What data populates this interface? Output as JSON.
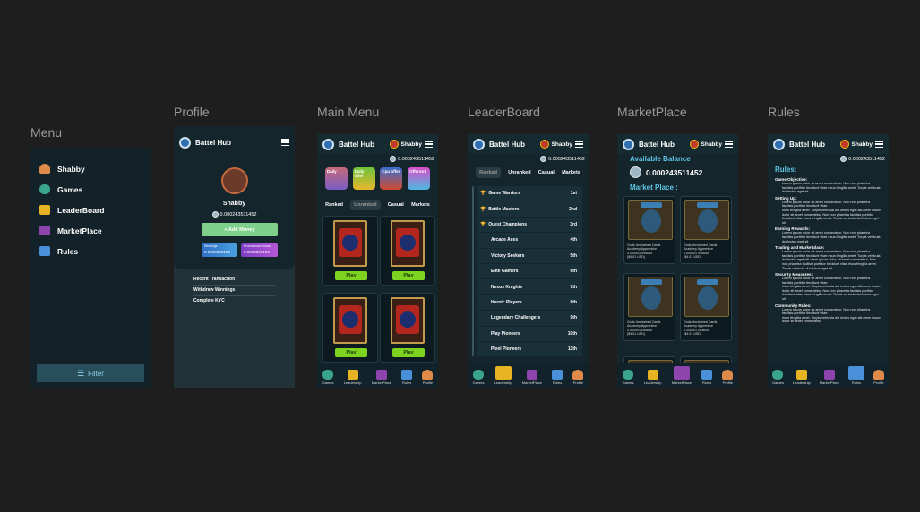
{
  "frames": {
    "menu": "Menu",
    "profile": "Profile",
    "main_menu": "Main Menu",
    "leaderboard": "LeaderBoard",
    "marketplace": "MarketPlace",
    "rules": "Rules"
  },
  "app_name": "Battel Hub",
  "user_name": "Shabby",
  "balance": "0.000243511452",
  "menu": {
    "items": [
      "Shabby",
      "Games",
      "LeaderBoard",
      "MarketPlace",
      "Rules"
    ],
    "filter": "Filter"
  },
  "profile": {
    "name": "Shabby",
    "balance": "0.000243511452",
    "add_money": "+ Add Money",
    "stat1_label": "Winnings",
    "stat1_value": "0.0000000123",
    "stat2_label": "Promotional Bonus",
    "stat2_value": "0.0000000123",
    "links": [
      "Recent Transaction",
      "Withdraw Winnings",
      "Complete KYC"
    ]
  },
  "main": {
    "offers": [
      "Daily",
      "Daily offer",
      "Cpu offer",
      "Offeroo1"
    ],
    "tabs": [
      "Ranked",
      "Unranked",
      "Casual",
      "Markets"
    ],
    "play": "Play"
  },
  "leaderboard": {
    "tabs": [
      "Ranked",
      "Unranked",
      "Casual",
      "Markets"
    ],
    "rows": [
      {
        "name": "Game Warriors",
        "rank": "1st"
      },
      {
        "name": "Battle Masters",
        "rank": "2nd"
      },
      {
        "name": "Quest Champions",
        "rank": "3rd"
      },
      {
        "name": "Arcade Aces",
        "rank": "4th"
      },
      {
        "name": "Victory Seekers",
        "rank": "5th"
      },
      {
        "name": "Elite Gamers",
        "rank": "6th"
      },
      {
        "name": "Nexus Knights",
        "rank": "7th"
      },
      {
        "name": "Heroic Players",
        "rank": "8th"
      },
      {
        "name": "Legendary Challengers",
        "rank": "9th"
      },
      {
        "name": "Play Pioneers",
        "rank": "10th"
      },
      {
        "name": "Pixel Pioneers",
        "rank": "11th"
      }
    ]
  },
  "market": {
    "available_label": "Available Balance",
    "balance": "0.000243511452",
    "market_label": "Market Place :",
    "card_tag": "Unclaimed",
    "card_title": "Gods Unchained Cards",
    "card_sub": "Academy Apprentice",
    "card_price": "0.000001 095649",
    "card_usd": "($4.01 USD)"
  },
  "rules": {
    "title": "Rules:",
    "sections": [
      {
        "h": "Game Objective:",
        "items": [
          "Lorem ipsum dolor sit amet consectetur. Non non pharetra facilisis porttitor tincidunt vitae risus fringilla amet. Turpis vehicula dui lectus eget sit"
        ]
      },
      {
        "h": "Setting Up:",
        "items": [
          "Lorem ipsum dolor sit amet consectetur. Non non pharetra facilisis porttitor tincidunt vitae",
          "risus fringilla amet. Turpis vehicula dui lectus eget sitLorem ipsum dolor sit amet consectetur. Non non pharetra facilisis porttitor tincidunt vitae risus fringilla amet. Turpis vehicula dui lectus eget sit"
        ]
      },
      {
        "h": "Earning Rewards:",
        "items": [
          "Lorem ipsum dolor sit amet consectetur. Non non pharetra facilisis porttitor tincidunt vitae risus fringilla amet. Turpis vehicula dui lectus eget sit"
        ]
      },
      {
        "h": "Trading and Marketplace:",
        "items": [
          "Lorem ipsum dolor sit amet consectetur. Non non pharetra facilisis porttitor tincidunt vitae risus fringilla amet. Turpis vehicula dui lectus eget sitLorem ipsum dolor sit amet consectetur. Non non pharetra facilisis porttitor tincidunt vitae risus fringilla amet. Turpis vehicula dui lectus eget sit"
        ]
      },
      {
        "h": "Security Measures:",
        "items": [
          "Lorem ipsum dolor sit amet consectetur. Non non pharetra facilisis porttitor tincidunt vitae",
          "risus fringilla amet. Turpis vehicula dui lectus eget sitLorem ipsum dolor sit amet consectetur. Non non pharetra facilisis porttitor tincidunt vitae risus fringilla amet. Turpis vehicula dui lectus eget sit"
        ]
      },
      {
        "h": "Community Rules:",
        "items": [
          "Lorem ipsum dolor sit amet consectetur. Non non pharetra facilisis porttitor tincidunt vitae",
          "risus fringilla amet. Turpis vehicula dui lectus eget sitLorem ipsum dolor sit amet consectetur."
        ]
      }
    ]
  },
  "nav": [
    "Games",
    "Leadership",
    "MarketPlace",
    "Rules",
    "Profile"
  ]
}
